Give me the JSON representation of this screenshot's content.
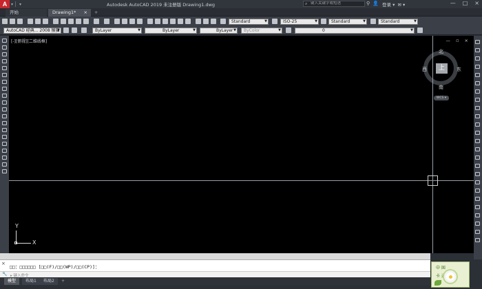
{
  "app": {
    "title": "Autodesk AutoCAD 2019    未注册版    Drawing1.dwg",
    "logo_letter": "A",
    "search_placeholder": "键入关键字或短语",
    "login_label": "登录"
  },
  "tabs": [
    {
      "label": "开始"
    },
    {
      "label": "Drawing1*"
    }
  ],
  "tab_close": "×",
  "tab_add": "+",
  "toolbar": {
    "text_style": "Standard",
    "dim_style": "ISO-25",
    "table_style": "Standard",
    "mleader_style": "Standard",
    "workspace": "AutoCAD 经典... 2008 猴猫",
    "color": "ByLayer",
    "linetype": "ByLayer",
    "lineweight": "ByLayer",
    "plotstyle": "ByColor",
    "layer": "0"
  },
  "viewport": {
    "label": "[-][俯视][二维线框]",
    "controls": "— ▫ ×"
  },
  "viewcube": {
    "face": "上",
    "north": "北",
    "south": "南",
    "east": "东",
    "west": "西",
    "wcs": "WCS ▾"
  },
  "ucs": {
    "x_label": "X",
    "y_label": "Y"
  },
  "command": {
    "close_icon": "×",
    "prompt": "□□：□□□□□□ [□□(F)/□□(WP)/□□(CP)]：",
    "key_icon": "🔧",
    "input_placeholder": "▸  键入命令"
  },
  "layout_tabs": [
    {
      "label": "模型",
      "active": true
    },
    {
      "label": "布局1",
      "active": false
    },
    {
      "label": "布局2",
      "active": false
    }
  ],
  "layout_add": "+",
  "logo": {
    "text_top": "中  国",
    "text_bottom": "卡  通"
  },
  "window_controls": [
    "—",
    "□",
    "×"
  ]
}
